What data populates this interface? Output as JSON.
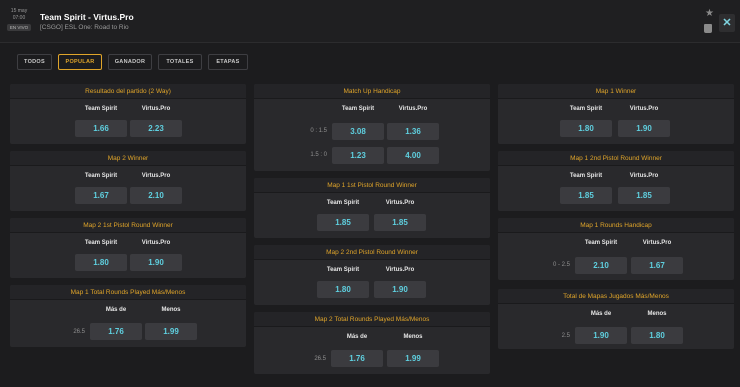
{
  "header": {
    "date": "15 may",
    "time": "07:00",
    "badge": "EN VIVO",
    "title": "Team Spirit - Virtus.Pro",
    "subtitle": "[CSGO] ESL One: Road to Rio",
    "icons": [
      "star-icon",
      "bag-icon",
      "close-icon"
    ],
    "close_symbol": "✕",
    "star_symbol": "★"
  },
  "tabs": [
    {
      "label": "TODOS",
      "active": false
    },
    {
      "label": "POPULAR",
      "active": true
    },
    {
      "label": "GANADOR",
      "active": false
    },
    {
      "label": "TOTALES",
      "active": false
    },
    {
      "label": "ETAPAS",
      "active": false
    }
  ],
  "colors": {
    "accent": "#e0a52a",
    "odds": "#5fd0e0",
    "background": "#1c1c1e",
    "card": "#29292c"
  },
  "cards": {
    "c1": {
      "title": "Resultado del partido (2 Way)",
      "labels": [
        "Team Spirit",
        "Virtus.Pro"
      ],
      "odds": [
        "1.66",
        "2.23"
      ]
    },
    "c2": {
      "title": "Map 2 Winner",
      "labels": [
        "Team Spirit",
        "Virtus.Pro"
      ],
      "odds": [
        "1.67",
        "2.10"
      ]
    },
    "c3": {
      "title": "Map 2 1st Pistol Round Winner",
      "labels": [
        "Team Spirit",
        "Virtus.Pro"
      ],
      "odds": [
        "1.80",
        "1.90"
      ]
    },
    "c4": {
      "title": "Map 1 Total Rounds Played Más/Menos",
      "labels": [
        "Más de",
        "Menos"
      ],
      "line": "26.5",
      "odds": [
        "1.76",
        "1.99"
      ]
    },
    "c5": {
      "title": "Match Up Handicap",
      "labels": [
        "Team Spirit",
        "Virtus.Pro"
      ],
      "rows": [
        {
          "line": "0 : 1.5",
          "odds": [
            "3.08",
            "1.36"
          ]
        },
        {
          "line": "1.5 : 0",
          "odds": [
            "1.23",
            "4.00"
          ]
        }
      ]
    },
    "c6": {
      "title": "Map 1 1st Pistol Round Winner",
      "labels": [
        "Team Spirit",
        "Virtus.Pro"
      ],
      "odds": [
        "1.85",
        "1.85"
      ]
    },
    "c7": {
      "title": "Map 2 2nd Pistol Round Winner",
      "labels": [
        "Team Spirit",
        "Virtus.Pro"
      ],
      "odds": [
        "1.80",
        "1.90"
      ]
    },
    "c8": {
      "title": "Map 2 Total Rounds Played Más/Menos",
      "labels": [
        "Más de",
        "Menos"
      ],
      "line": "26.5",
      "odds": [
        "1.76",
        "1.99"
      ]
    },
    "c9": {
      "title": "Map 1 Winner",
      "labels": [
        "Team Spirit",
        "Virtus.Pro"
      ],
      "odds": [
        "1.80",
        "1.90"
      ]
    },
    "c10": {
      "title": "Map 1 2nd Pistol Round Winner",
      "labels": [
        "Team Spirit",
        "Virtus.Pro"
      ],
      "odds": [
        "1.85",
        "1.85"
      ]
    },
    "c11": {
      "title": "Map 1 Rounds Handicap",
      "labels": [
        "Team Spirit",
        "Virtus.Pro"
      ],
      "line": "0 - 2.5",
      "odds": [
        "2.10",
        "1.67"
      ]
    },
    "c12": {
      "title": "Total de Mapas Jugados Más/Menos",
      "labels": [
        "Más de",
        "Menos"
      ],
      "line": "2.5",
      "odds": [
        "1.90",
        "1.80"
      ]
    }
  }
}
